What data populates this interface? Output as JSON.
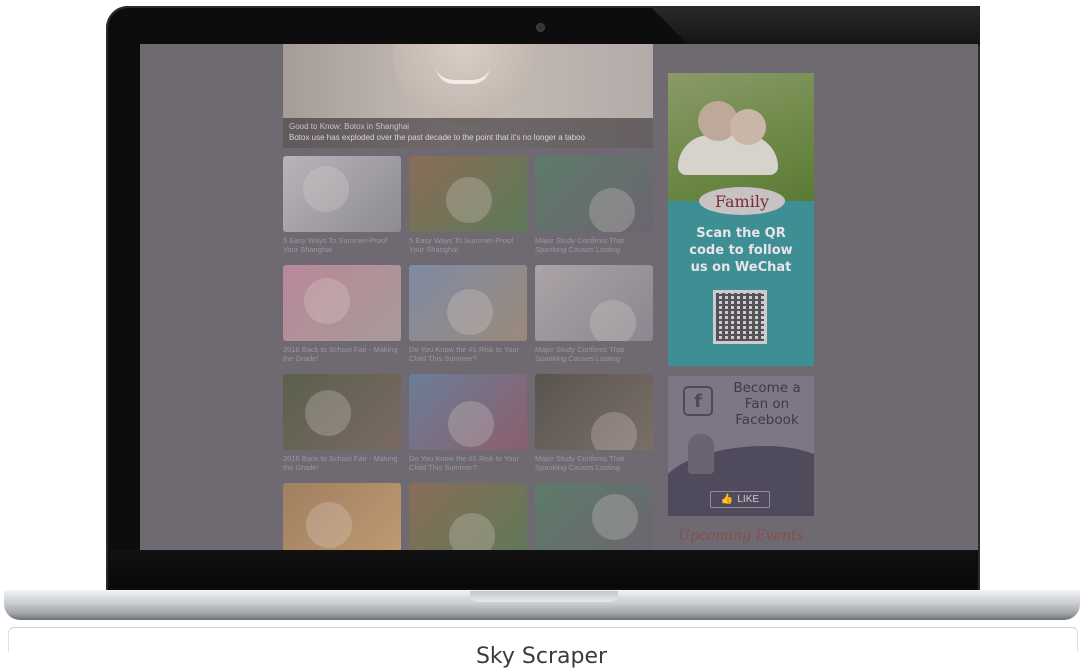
{
  "hero": {
    "title": "Good to Know: Botox in Shanghai",
    "description": "Botox use has exploded over the past decade to the point that it's no longer a taboo"
  },
  "articles": [
    {
      "label": "5 Easy Ways To Summer-Proof Your Shanghai",
      "colors": [
        "#b9b4ba",
        "#8d8a92"
      ]
    },
    {
      "label": "5 Easy Ways To Summer-Proof Your Shanghai",
      "colors": [
        "#8a6c58",
        "#5d7a58"
      ]
    },
    {
      "label": "Major Study Confirms That Spanking Causes Lasting",
      "colors": [
        "#5e7b6a",
        "#6b6570"
      ]
    },
    {
      "label": "2016 Back to School Fair - Making the Grade!",
      "colors": [
        "#b8889a",
        "#a89a98"
      ]
    },
    {
      "label": "Do You Know the #1 Risk to Your Child This Summer?",
      "colors": [
        "#7f8aa4",
        "#9b8a7a"
      ]
    },
    {
      "label": "Major Study Confirms That Spanking Causes Lasting",
      "colors": [
        "#aba3a6",
        "#8a8790"
      ]
    },
    {
      "label": "2016 Back to School Fair - Making the Grade!",
      "colors": [
        "#5b5f4e",
        "#7a6a62"
      ]
    },
    {
      "label": "Do You Know the #1 Risk to Your Child This Summer?",
      "colors": [
        "#6a7e96",
        "#8c5e6e"
      ]
    },
    {
      "label": "Major Study Confirms That Spanking Causes Lasting",
      "colors": [
        "#5a544e",
        "#7b6f68"
      ]
    },
    {
      "label": "",
      "colors": [
        "#a08060",
        "#c09a72"
      ]
    },
    {
      "label": "",
      "colors": [
        "#8a6c58",
        "#5d7a58"
      ]
    },
    {
      "label": "",
      "colors": [
        "#5e7b6a",
        "#6b6570"
      ]
    }
  ],
  "ad": {
    "logo": "Family",
    "line1": "Scan the QR",
    "line2": "code to follow",
    "line3": "us on WeChat"
  },
  "facebook": {
    "icon": "f",
    "line1": "Become a",
    "line2": "Fan on",
    "line3": "Facebook",
    "like": "LIKE"
  },
  "events": {
    "label": "Upcoming Events"
  },
  "caption": "Sky Scraper"
}
